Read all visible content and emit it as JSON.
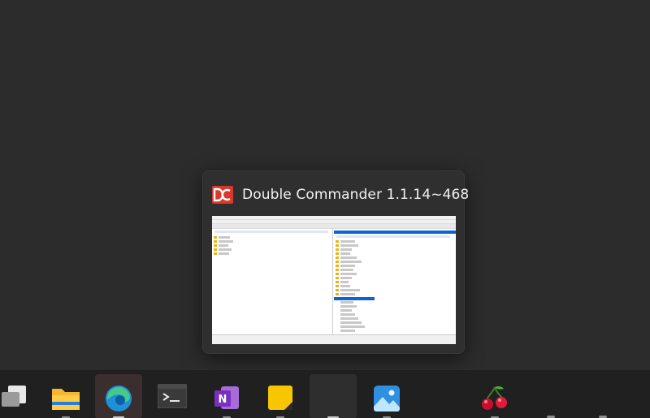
{
  "preview": {
    "title": "Double Commander 1.1.14~468",
    "app_icon": "double-commander-icon"
  },
  "taskbar": {
    "items": [
      {
        "name": "task-view-icon"
      },
      {
        "name": "file-explorer-icon"
      },
      {
        "name": "edge-icon"
      },
      {
        "name": "terminal-icon"
      },
      {
        "name": "onenote-icon"
      },
      {
        "name": "sticky-notes-icon"
      },
      {
        "name": "double-commander-icon"
      },
      {
        "name": "photos-icon"
      },
      {
        "name": "cherrytree-icon"
      }
    ]
  },
  "colors": {
    "background": "#2c2c2c",
    "taskbar": "#202020",
    "logo_red": "#d9392c",
    "selection": "#0a64d6"
  }
}
